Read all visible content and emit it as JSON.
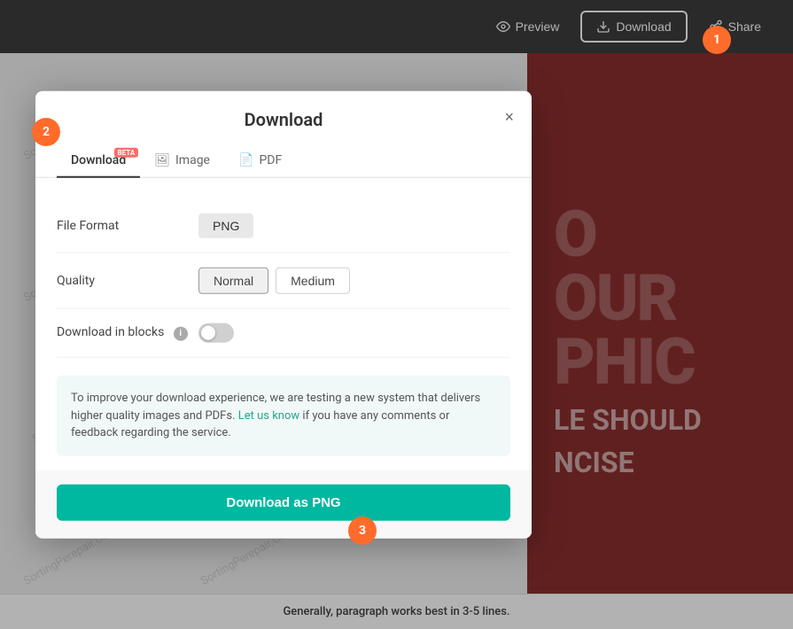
{
  "toolbar": {
    "preview_label": "Preview",
    "download_label": "Download",
    "share_label": "Share"
  },
  "modal": {
    "title": "Download",
    "close_label": "×",
    "tabs": [
      {
        "id": "download",
        "label": "Download",
        "active": true,
        "has_beta": true
      },
      {
        "id": "image",
        "label": "Image",
        "active": false,
        "has_beta": false
      },
      {
        "id": "pdf",
        "label": "PDF",
        "active": false,
        "has_beta": false
      }
    ],
    "fields": {
      "file_format": {
        "label": "File Format",
        "value": "PNG"
      },
      "quality": {
        "label": "Quality",
        "options": [
          "Normal",
          "Medium"
        ],
        "selected": "Normal"
      },
      "download_in_blocks": {
        "label": "Download in blocks",
        "enabled": false
      }
    },
    "info_box": {
      "text_before": "To improve your download experience, we are testing a new system that delivers higher quality images and PDFs.",
      "link_text": "Let us know",
      "text_after": "if you have any comments or feedback regarding the service."
    },
    "cta_button": "Download as PNG"
  },
  "badges": {
    "badge1": "1",
    "badge2": "2",
    "badge3": "3"
  },
  "bottom_text": "Generally, paragraph works best in 3-5 lines.",
  "design": {
    "line1": "O",
    "line2": "OUR",
    "line3": "PHIC",
    "line4": "LE SHOULD",
    "line5": "NCISE"
  },
  "watermark": "SortingPerepair.Com",
  "beta_badge": "BETA"
}
